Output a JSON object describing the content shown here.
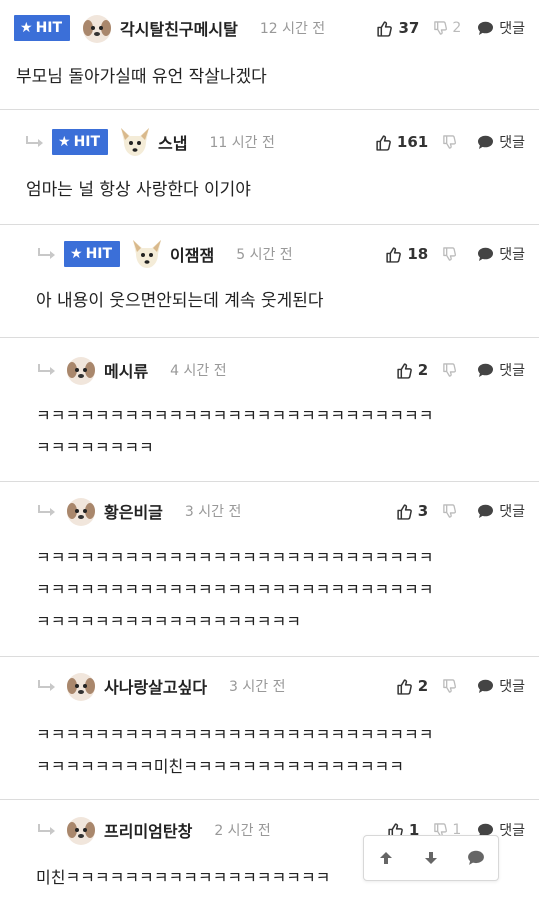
{
  "hit_label": "HIT",
  "reply_label": "댓글",
  "comments": [
    {
      "nick": "각시탈친구메시탈",
      "time": "12 시간 전",
      "likes": "37",
      "dislikes": "2",
      "text": "부모님 돌아가실때 유언 작살나겠다"
    },
    {
      "nick": "스냅",
      "time": "11 시간 전",
      "likes": "161",
      "dislikes": "",
      "text": "엄마는 널 항상 사랑한다 이기야"
    },
    {
      "nick": "이잼잼",
      "time": "5 시간 전",
      "likes": "18",
      "dislikes": "",
      "text": "아 내용이 웃으면안되는데 계속 웃게된다"
    },
    {
      "nick": "메시류",
      "time": "4 시간 전",
      "likes": "2",
      "dislikes": "",
      "text": "ㅋㅋㅋㅋㅋㅋㅋㅋㅋㅋㅋㅋㅋㅋㅋㅋㅋㅋㅋㅋㅋㅋㅋㅋㅋㅋㅋ\nㅋㅋㅋㅋㅋㅋㅋㅋ"
    },
    {
      "nick": "황은비글",
      "time": "3 시간 전",
      "likes": "3",
      "dislikes": "",
      "text": "ㅋㅋㅋㅋㅋㅋㅋㅋㅋㅋㅋㅋㅋㅋㅋㅋㅋㅋㅋㅋㅋㅋㅋㅋㅋㅋㅋ\nㅋㅋㅋㅋㅋㅋㅋㅋㅋㅋㅋㅋㅋㅋㅋㅋㅋㅋㅋㅋㅋㅋㅋㅋㅋㅋㅋ\nㅋㅋㅋㅋㅋㅋㅋㅋㅋㅋㅋㅋㅋㅋㅋㅋㅋㅋ"
    },
    {
      "nick": "사나랑살고싶다",
      "time": "3 시간 전",
      "likes": "2",
      "dislikes": "",
      "text": "ㅋㅋㅋㅋㅋㅋㅋㅋㅋㅋㅋㅋㅋㅋㅋㅋㅋㅋㅋㅋㅋㅋㅋㅋㅋㅋㅋ\nㅋㅋㅋㅋㅋㅋㅋㅋ미친ㅋㅋㅋㅋㅋㅋㅋㅋㅋㅋㅋㅋㅋㅋㅋ"
    },
    {
      "nick": "프리미엄탄창",
      "time": "2 시간 전",
      "likes": "1",
      "dislikes": "1",
      "text": "미친ㅋㅋㅋㅋㅋㅋㅋㅋㅋㅋㅋㅋㅋㅋㅋㅋㅋㅋ"
    }
  ],
  "colors": {
    "hit_bg": "#3b6fd8",
    "meta_gray": "#999999",
    "border": "#dcdcdc"
  },
  "icons": {
    "like": "thumbs-up-icon",
    "dislike": "thumbs-down-icon",
    "reply": "speech-bubble-icon",
    "reply_indent": "reply-arrow-icon",
    "scroll_up": "arrow-up-icon",
    "scroll_down": "arrow-down-icon",
    "chat": "chat-icon"
  }
}
